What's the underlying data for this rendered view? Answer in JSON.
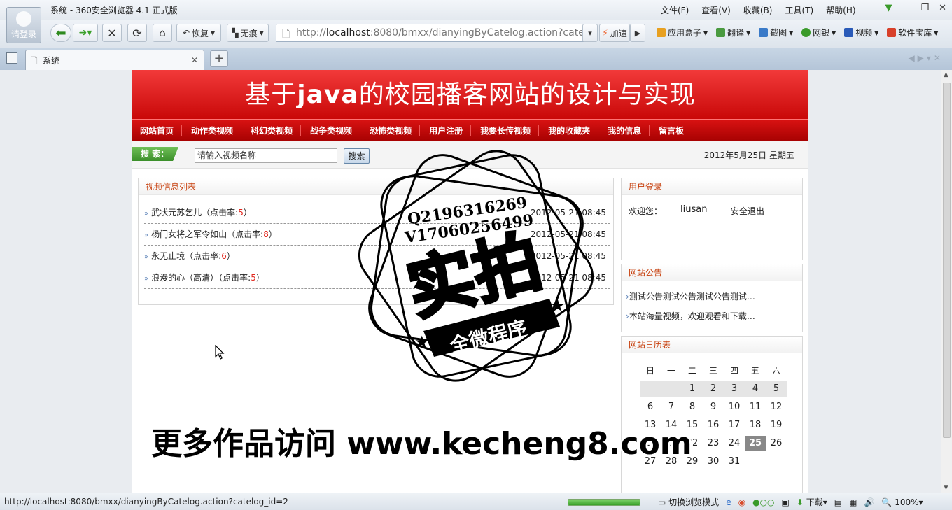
{
  "window": {
    "title": "系统 - 360安全浏览器 4.1 正式版",
    "avatar_label": "请登录",
    "menu": [
      "文件(F)",
      "查看(V)",
      "收藏(B)",
      "工具(T)",
      "帮助(H)"
    ]
  },
  "toolbar": {
    "restore_label": "恢复",
    "incognito_label": "无痕",
    "url_prefix": "http://",
    "url_host": "localhost",
    "url_rest": ":8080/bmxx/dianyingByCatelog.action?catelo",
    "accelerate_label": "加速",
    "extras": [
      "应用盒子",
      "翻译",
      "截图",
      "网银",
      "视频",
      "软件宝库"
    ]
  },
  "tab": {
    "title": "系统",
    "new_tab": "+"
  },
  "site": {
    "banner_pre": "基于",
    "banner_java": "java",
    "banner_post": "的校园播客网站的设计与实现",
    "nav": [
      "网站首页",
      "动作类视频",
      "科幻类视频",
      "战争类视频",
      "恐怖类视频",
      "用户注册",
      "我要长传视频",
      "我的收藏夹",
      "我的信息",
      "留言板"
    ],
    "search_label": "搜 索：",
    "search_placeholder": "请输入视频名称",
    "search_button": "搜索",
    "date": "2012年5月25日 星期五"
  },
  "video_list": {
    "title": "视频信息列表",
    "hits_prefix": "（点击率:",
    "hits_suffix": "）",
    "items": [
      {
        "name": "武状元苏乞儿",
        "hits": "5",
        "date": "2012-05-21 08:45"
      },
      {
        "name": "杨门女将之军令如山",
        "hits": "8",
        "date": "2012-05-21 08:45"
      },
      {
        "name": "永无止境",
        "hits": "6",
        "date": "2012-05-21 08:45"
      },
      {
        "name": "浪漫的心（高清）",
        "hits": "5",
        "date": "2012-05-21 08:45"
      }
    ]
  },
  "login": {
    "title": "用户登录",
    "welcome": "欢迎您：",
    "user": "liusan",
    "logout": "安全退出"
  },
  "notice": {
    "title": "网站公告",
    "items": [
      "测试公告测试公告测试公告测试…",
      "本站海量视频，欢迎观看和下载…"
    ]
  },
  "calendar": {
    "title": "网站日历表",
    "weekdays": [
      "日",
      "一",
      "二",
      "三",
      "四",
      "五",
      "六"
    ],
    "weeks": [
      [
        "",
        "",
        "1",
        "2",
        "3",
        "4",
        "5"
      ],
      [
        "6",
        "7",
        "8",
        "9",
        "10",
        "11",
        "12"
      ],
      [
        "13",
        "14",
        "15",
        "16",
        "17",
        "18",
        "19"
      ],
      [
        "20",
        "21",
        "22",
        "23",
        "24",
        "25",
        "26"
      ],
      [
        "27",
        "28",
        "29",
        "30",
        "31",
        "",
        ""
      ]
    ],
    "today": "25"
  },
  "status": {
    "url": "http://localhost:8080/bmxx/dianyingByCatelog.action?catelog_id=2",
    "progress": 1.0,
    "mode": "切换浏览模式",
    "download": "下载",
    "zoom": "100%"
  },
  "watermark": {
    "qq": "Q2196316269",
    "v": "V17060256499",
    "main": "实拍",
    "sub": "全微程序",
    "footer": "更多作品访问 www.kecheng8.com"
  }
}
